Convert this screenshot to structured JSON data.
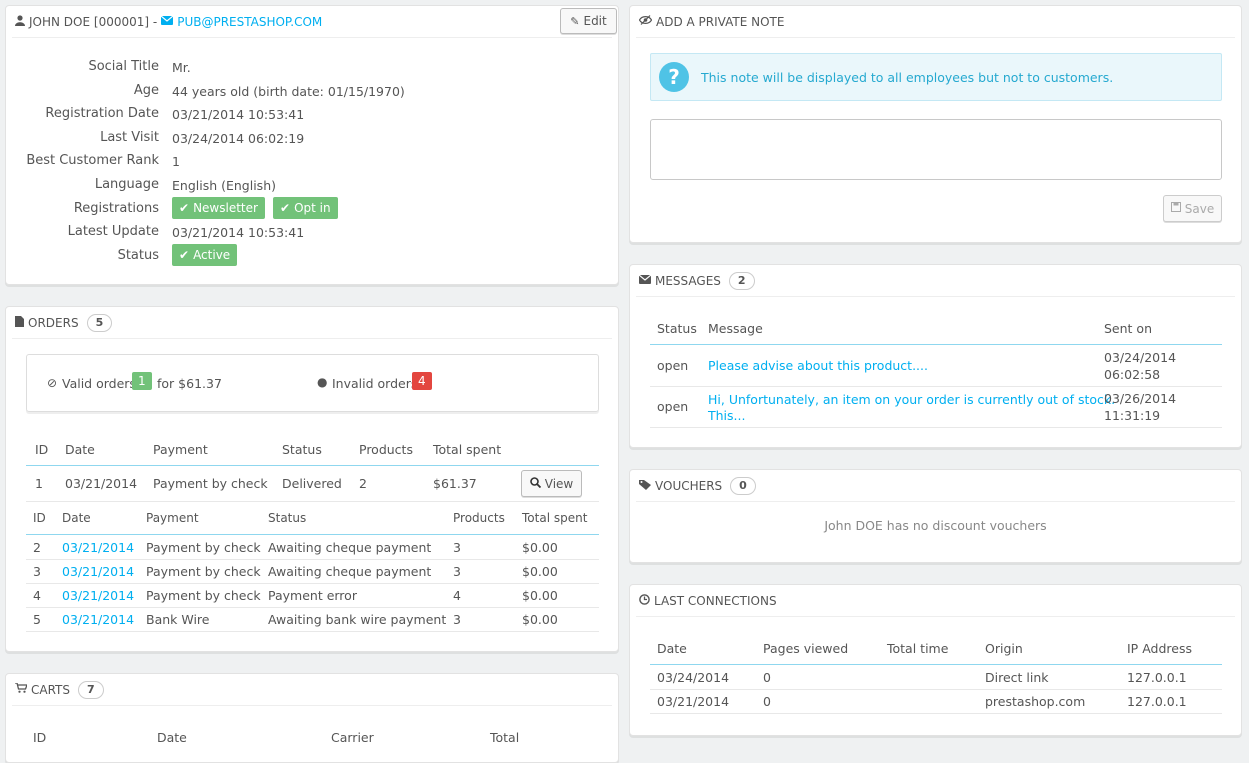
{
  "customer": {
    "name": "JOHN DOE [000001] -",
    "email": "PUB@PRESTASHOP.COM",
    "edit_label": "Edit",
    "fields": [
      {
        "label": "Social Title",
        "value": "Mr."
      },
      {
        "label": "Age",
        "value": "44 years old (birth date: 01/15/1970)"
      },
      {
        "label": "Registration Date",
        "value": "03/21/2014 10:53:41"
      },
      {
        "label": "Last Visit",
        "value": "03/24/2014 06:02:19"
      },
      {
        "label": "Best Customer Rank",
        "value": "1"
      },
      {
        "label": "Language",
        "value": "English (English)"
      },
      {
        "label": "Registrations",
        "value": ""
      },
      {
        "label": "Latest Update",
        "value": "03/21/2014 10:53:41"
      },
      {
        "label": "Status",
        "value": ""
      }
    ],
    "newsletter_label": "Newsletter",
    "optin_label": "Opt in",
    "status_label": "Active"
  },
  "orders": {
    "title": "ORDERS",
    "count": "5",
    "valid_label": "Valid orders",
    "valid_count": "1",
    "valid_for": "for $61.37",
    "invalid_label": "Invalid orders",
    "invalid_count": "4",
    "valid_headers": [
      "ID",
      "Date",
      "Payment",
      "Status",
      "Products",
      "Total spent"
    ],
    "valid_rows": [
      {
        "id": "1",
        "date": "03/21/2014",
        "payment": "Payment by check",
        "status": "Delivered",
        "products": "2",
        "total": "$61.37"
      }
    ],
    "view_label": "View",
    "invalid_headers": [
      "ID",
      "Date",
      "Payment",
      "Status",
      "Products",
      "Total spent"
    ],
    "invalid_rows": [
      {
        "id": "2",
        "date": "03/21/2014",
        "payment": "Payment by check",
        "status": "Awaiting cheque payment",
        "products": "3",
        "total": "$0.00"
      },
      {
        "id": "3",
        "date": "03/21/2014",
        "payment": "Payment by check",
        "status": "Awaiting cheque payment",
        "products": "3",
        "total": "$0.00"
      },
      {
        "id": "4",
        "date": "03/21/2014",
        "payment": "Payment by check",
        "status": "Payment error",
        "products": "4",
        "total": "$0.00"
      },
      {
        "id": "5",
        "date": "03/21/2014",
        "payment": "Bank Wire",
        "status": "Awaiting bank wire payment",
        "products": "3",
        "total": "$0.00"
      }
    ]
  },
  "carts": {
    "title": "CARTS",
    "count": "7",
    "headers": [
      "ID",
      "Date",
      "Carrier",
      "Total"
    ]
  },
  "note": {
    "title": "ADD A PRIVATE NOTE",
    "info": "This note will be displayed to all employees but not to customers.",
    "textarea_value": "",
    "save_label": "Save"
  },
  "messages": {
    "title": "MESSAGES",
    "count": "2",
    "headers": [
      "Status",
      "Message",
      "Sent on"
    ],
    "rows": [
      {
        "status": "open",
        "message_1": "Please advise about this product....",
        "message_2": "",
        "date": "03/24/2014",
        "time": "06:02:58"
      },
      {
        "status": "open",
        "message_1": "Hi, Unfortunately, an item on your order is currently out of stock.",
        "message_2": "This...",
        "date": "03/26/2014",
        "time": "11:31:19"
      }
    ]
  },
  "vouchers": {
    "title": "VOUCHERS",
    "count": "0",
    "empty_text": "John DOE has no discount vouchers"
  },
  "connections": {
    "title": "LAST CONNECTIONS",
    "headers": [
      "Date",
      "Pages viewed",
      "Total time",
      "Origin",
      "IP Address"
    ],
    "rows": [
      {
        "date": "03/24/2014",
        "pages": "0",
        "time": "",
        "origin": "Direct link",
        "ip": "127.0.0.1"
      },
      {
        "date": "03/21/2014",
        "pages": "0",
        "time": "",
        "origin": "prestashop.com",
        "ip": "127.0.0.1"
      }
    ]
  },
  "colors": {
    "accent": "#00aff0",
    "success": "#72c279",
    "danger": "#e3463f",
    "info_bg": "#eaf7fb"
  }
}
